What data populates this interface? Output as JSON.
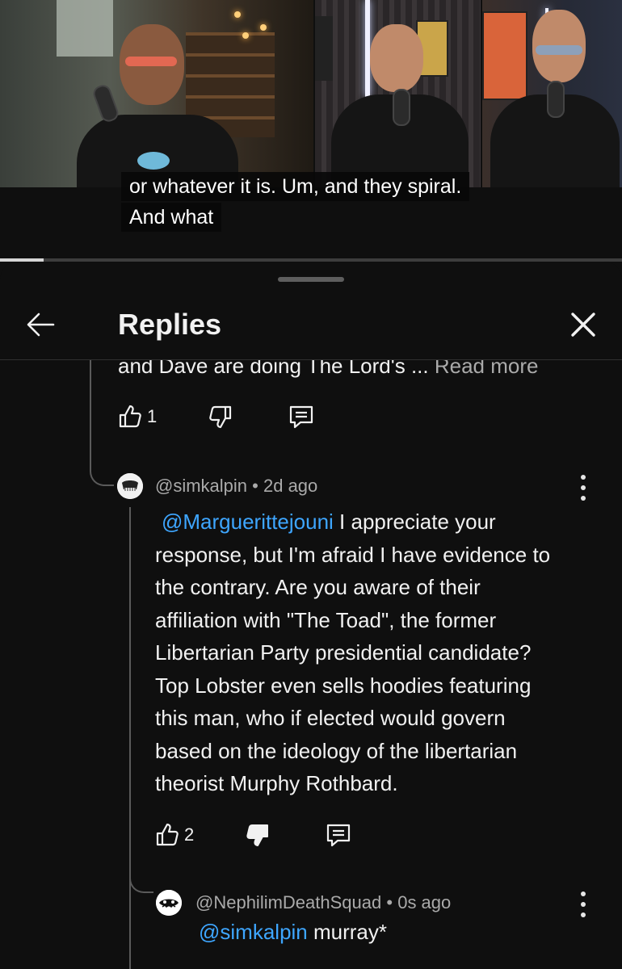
{
  "video": {
    "captions": [
      "or whatever it is. Um, and they spiral.",
      "And what"
    ],
    "progress": 0.07
  },
  "sheet": {
    "title": "Replies",
    "back_icon": "arrow-left-icon",
    "close_icon": "close-icon"
  },
  "truncated_comment": {
    "text_visible": "and Dave are doing The Lord's ...",
    "read_more": "Read more",
    "likes": "1"
  },
  "replies": [
    {
      "author": "@simkalpin",
      "age": "2d ago",
      "mention": "@Marguerittejouni",
      "lines": [
        " I appreciate your",
        "response, but I'm afraid I have evidence to",
        "the contrary. Are you aware of their",
        "affiliation with \"The Toad\", the former",
        "Libertarian Party presidential candidate?",
        "Top Lobster even sells hoodies featuring",
        "this man, who if elected would govern",
        "based on the ideology of the libertarian",
        "theorist Murphy Rothbard."
      ],
      "likes": "2",
      "disliked": true
    },
    {
      "author": "@NephilimDeathSquad",
      "age": "0s ago",
      "mention": "@simkalpin",
      "text": " murray*"
    }
  ]
}
